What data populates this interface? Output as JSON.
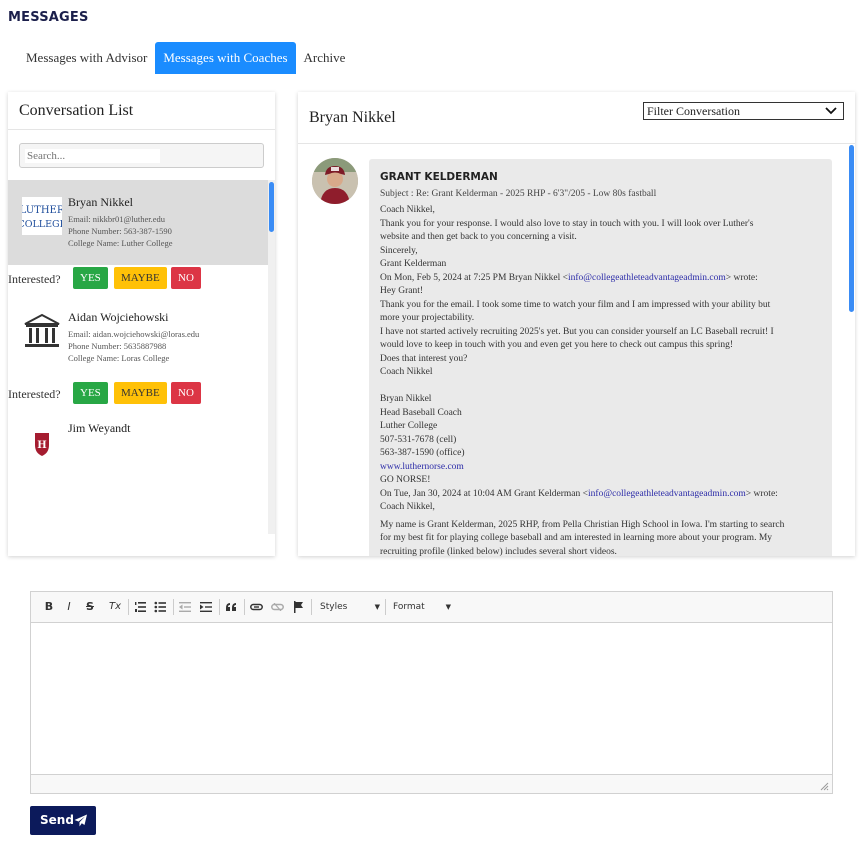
{
  "page": {
    "title": "MESSAGES"
  },
  "tabs": [
    {
      "label": "Messages with Advisor",
      "active": false
    },
    {
      "label": "Messages with Coaches",
      "active": true
    },
    {
      "label": "Archive",
      "active": false
    }
  ],
  "conversation_list": {
    "title": "Conversation List",
    "search_placeholder": "Search...",
    "interested_label": "Interested?",
    "buttons": {
      "yes": "YES",
      "maybe": "MAYBE",
      "no": "NO"
    },
    "items": [
      {
        "name": "Bryan Nikkel",
        "email": "Email: nikkbr01@luther.edu",
        "phone": "Phone Number: 563-387-1590",
        "college": "College Name: Luther College",
        "logo": "luther-college-logo",
        "logo_text_1": "LUTHER",
        "logo_text_2": "COLLEGE",
        "selected": true
      },
      {
        "name": "Aidan Wojciehowski",
        "email": "Email: aidan.wojciehowski@loras.edu",
        "phone": "Phone Number: 5635887988",
        "college": "College Name: Loras College",
        "logo": "building-icon",
        "selected": false
      },
      {
        "name": "Jim Weyandt",
        "logo": "harvard-shield-icon",
        "logo_text": "H",
        "selected": false
      }
    ]
  },
  "conversation": {
    "title": "Bryan Nikkel",
    "filter_label": "Filter Conversation",
    "message": {
      "sender": "GRANT KELDERMAN",
      "subject": "Subject : Re: Grant Kelderman - 2025 RHP - 6'3\"/205 - Low 80s fastball",
      "lines": [
        "Coach Nikkel,",
        "Thank you for your response. I would also love to stay in touch with you. I will look over Luther's",
        "website and then get back to you concerning a visit.",
        "Sincerely,",
        "Grant Kelderman",
        "Hey Grant!",
        "Thank you for the email. I took some time to watch your film and I am impressed with your ability but",
        "more your projectability.",
        "I have not started actively recruiting 2025's yet. But you can consider yourself an LC Baseball recruit! I",
        "would love to keep in touch with you and even get you here to check out campus this spring!",
        "Does that interest you?",
        "Coach Nikkel",
        "Bryan Nikkel",
        "Head Baseball Coach",
        "Luther College",
        "507-531-7678 (cell)",
        "563-387-1590 (office)",
        "www.luthernorse.com",
        "GO NORSE!",
        "Coach Nikkel,",
        "My name is Grant Kelderman, 2025 RHP, from Pella Christian High School in Iowa. I'm starting to search",
        "for my best fit for playing college baseball and am interested in learning more about your program. My",
        "recruiting profile (linked below) includes several short videos."
      ],
      "quote_1_prefix": "On Mon, Feb 5, 2024 at 7:25 PM Bryan Nikkel <",
      "quote_1_email": "info@collegeathleteadvantageadmin.com",
      "quote_1_suffix": "> wrote:",
      "quote_2_prefix": "On Tue, Jan 30, 2024 at 10:04 AM Grant Kelderman <",
      "quote_2_email": "info@collegeathleteadvantageadmin.com",
      "quote_2_suffix": "> wrote:"
    }
  },
  "editor": {
    "toolbar": {
      "bold": "B",
      "italic": "I",
      "strike": "S",
      "clear_format": "Tx",
      "styles": "Styles",
      "format": "Format"
    }
  },
  "send": {
    "label": "Send"
  },
  "colors": {
    "accent": "#1a8cff",
    "send": "#0c1a5b",
    "yes": "#28a745",
    "maybe": "#ffc107",
    "no": "#dc3545",
    "scrollbar": "#3a8cf5"
  }
}
